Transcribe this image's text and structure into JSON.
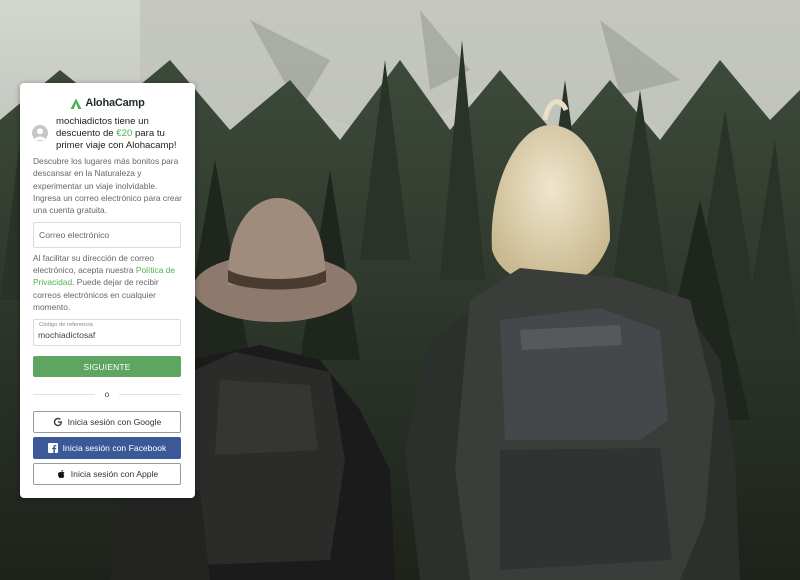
{
  "brand": {
    "name": "AlohaCamp",
    "accent_color": "#4caf50",
    "button_color": "#5fa562",
    "facebook_color": "#3b5998"
  },
  "promo": {
    "text_before": "mochiadictos tiene un descuento de ",
    "amount": "€20",
    "text_after": " para tu primer viaje con Alohacamp!"
  },
  "description": "Descubre los lugares más bonitos para descansar en la Naturaleza y experimentar un viaje inolvidable. Ingresa un correo electrónico para crear una cuenta gratuita.",
  "email": {
    "placeholder": "Correo electrónico",
    "value": ""
  },
  "legal": {
    "text_before": "Al facilitar su dirección de correo electrónico, acepta nuestra ",
    "link": "Política de Privacidad",
    "text_after": ". Puede dejar de recibir correos electrónicos en cualquier momento."
  },
  "referral": {
    "label": "Código de referencia",
    "value": "mochiadictosaf"
  },
  "next_button": "SIGUIENTE",
  "divider_text": "o",
  "social": {
    "google": {
      "label": "Inicia sesión con Google",
      "icon": "google-icon"
    },
    "facebook": {
      "label": "Inicia sesión con Facebook",
      "icon": "facebook-icon"
    },
    "apple": {
      "label": "Inicia sesión con Apple",
      "icon": "apple-icon"
    }
  },
  "background": {
    "description_icon": "hikers-forest-photo"
  }
}
